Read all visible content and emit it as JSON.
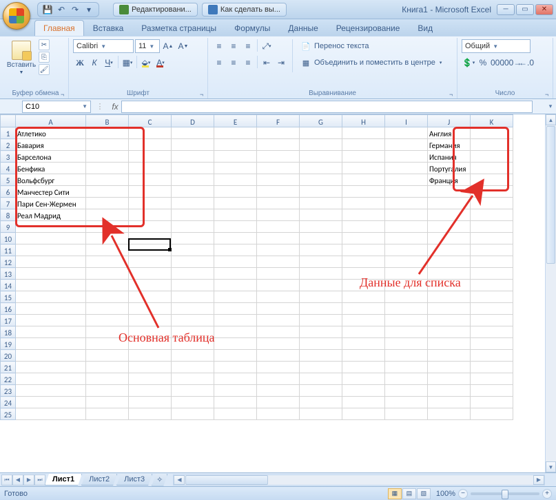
{
  "title": "Книга1 - Microsoft Excel",
  "qat": {
    "save": "💾",
    "undo": "↶",
    "redo": "↷",
    "more": "▾"
  },
  "taskbar": [
    {
      "icon": "a",
      "label": "Редактировани..."
    },
    {
      "icon": "b",
      "label": "Как сделать вы..."
    }
  ],
  "tabs": {
    "home": "Главная",
    "insert": "Вставка",
    "page": "Разметка страницы",
    "formulas": "Формулы",
    "data": "Данные",
    "review": "Рецензирование",
    "view": "Вид"
  },
  "ribbon": {
    "clipboard": {
      "paste": "Вставить",
      "label": "Буфер обмена"
    },
    "font": {
      "name": "Calibri",
      "size": "11",
      "bold": "Ж",
      "italic": "К",
      "underline": "Ч",
      "label": "Шрифт"
    },
    "align": {
      "wrap": "Перенос текста",
      "merge": "Объединить и поместить в центре",
      "label": "Выравнивание"
    },
    "number": {
      "format": "Общий",
      "label": "Число"
    }
  },
  "namebox": "C10",
  "columns": [
    "A",
    "B",
    "C",
    "D",
    "E",
    "F",
    "G",
    "H",
    "I",
    "J",
    "K"
  ],
  "rows": 25,
  "dataA": [
    "Атлетико",
    "Бавария",
    "Барселона",
    "Бенфика",
    "Вольфсбург",
    "Манчестер Сити",
    "Пари Сен-Жермен",
    "Реал Мадрид"
  ],
  "dataJ": [
    "Англия",
    "Германия",
    "Испания",
    "Португалия",
    "Франция"
  ],
  "annotations": {
    "main": "Основная таблица",
    "list": "Данные для списка"
  },
  "sheets": {
    "s1": "Лист1",
    "s2": "Лист2",
    "s3": "Лист3"
  },
  "status": {
    "ready": "Готово",
    "zoom": "100%"
  },
  "active_cell": "C10"
}
